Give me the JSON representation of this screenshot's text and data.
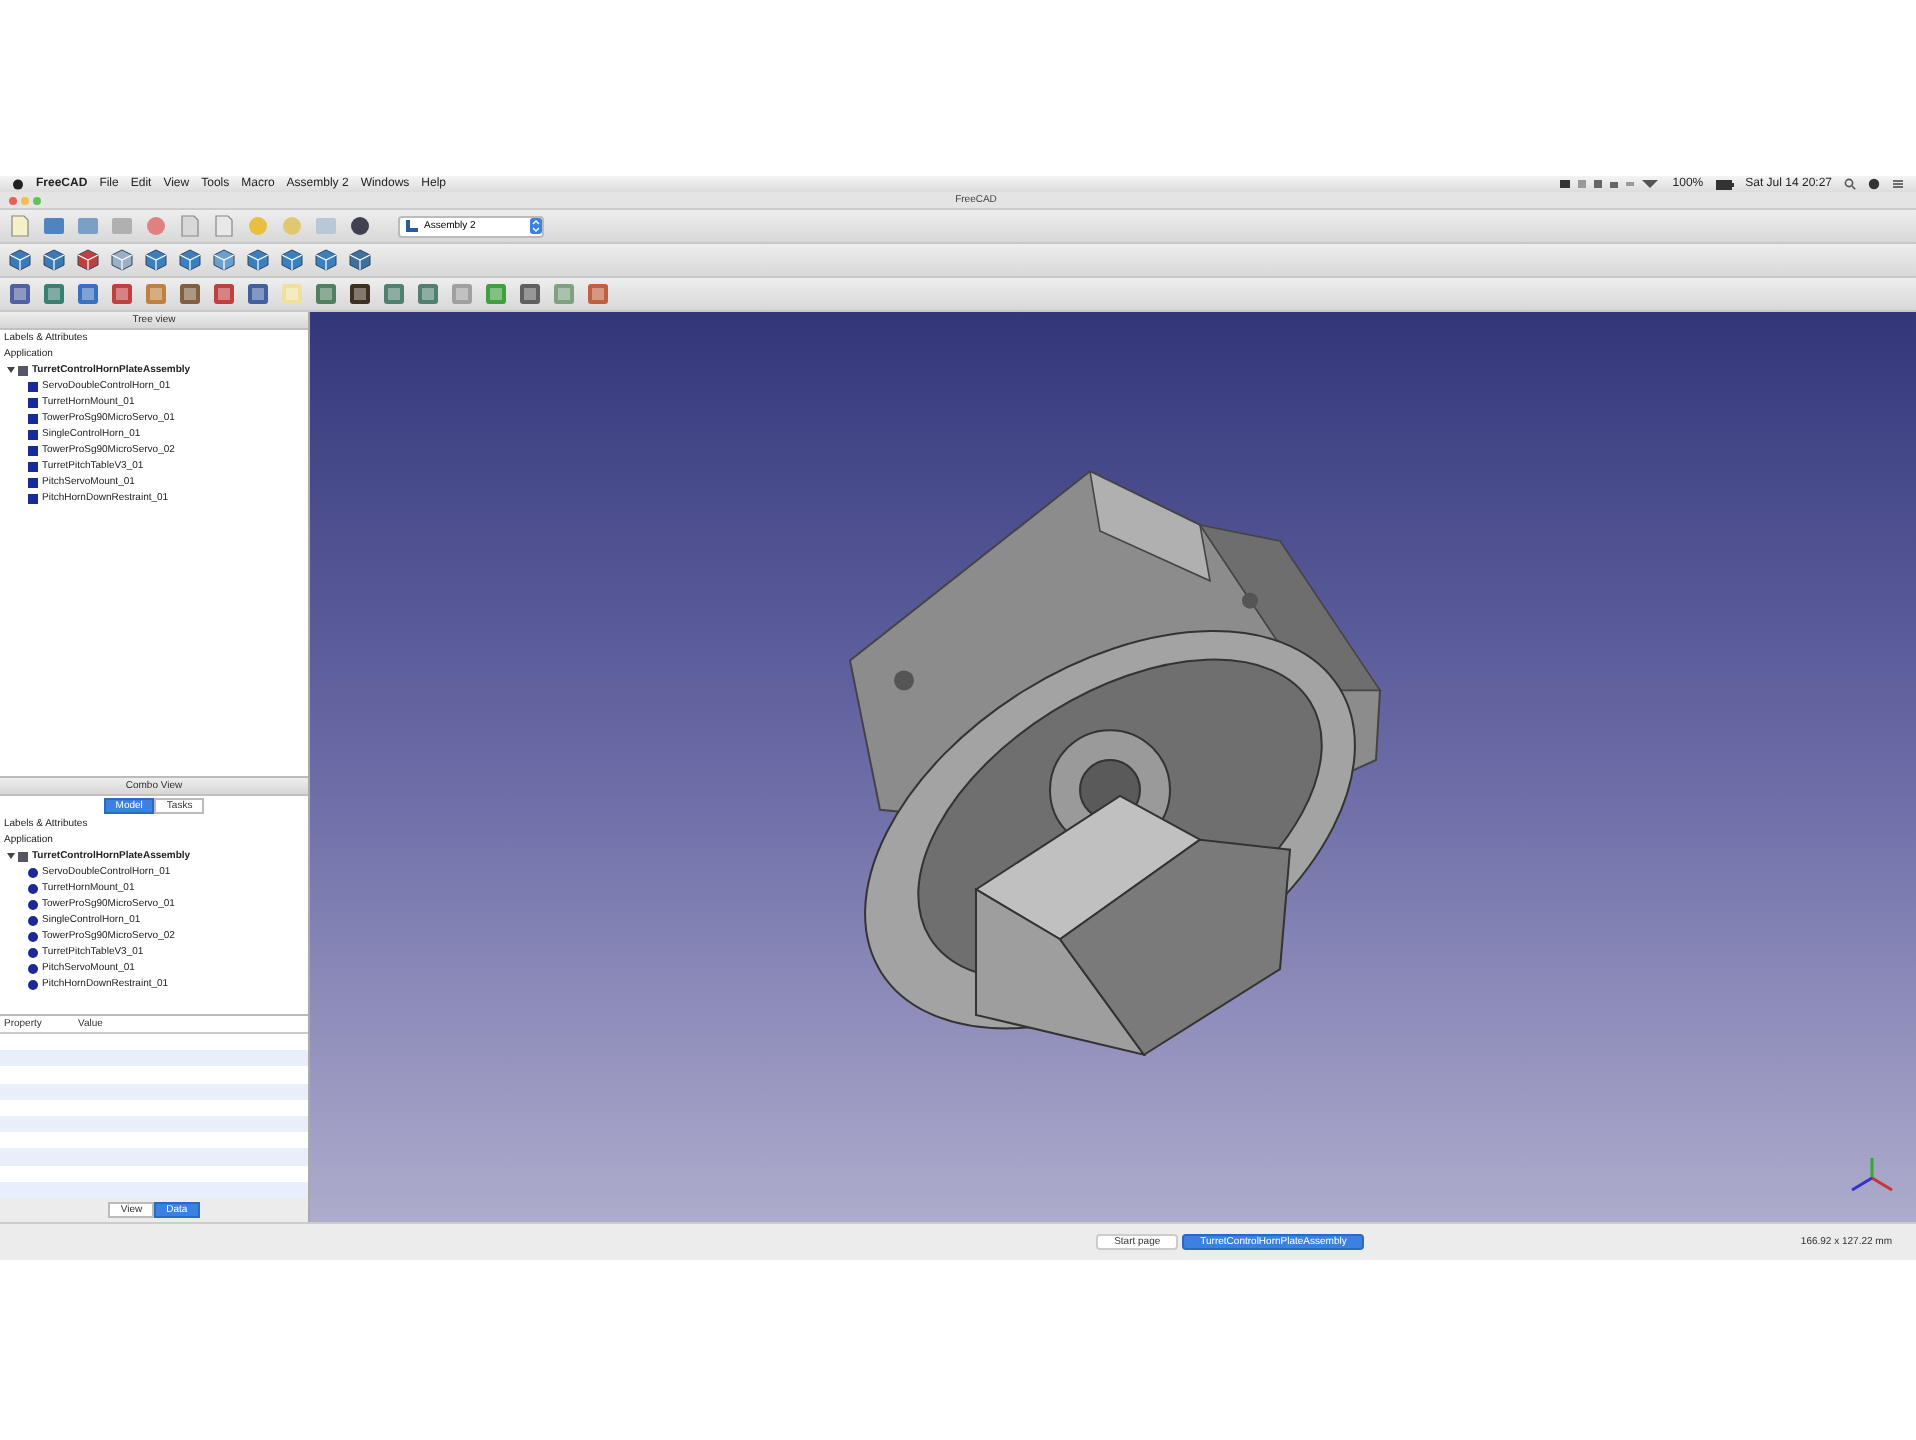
{
  "menu_bar": {
    "app": "FreeCAD",
    "items": [
      "File",
      "Edit",
      "View",
      "Tools",
      "Macro",
      "Assembly 2",
      "Windows",
      "Help"
    ],
    "battery": "100%",
    "clock": "Sat Jul 14 20:27"
  },
  "window": {
    "title": "FreeCAD"
  },
  "workbench_selector": {
    "value": "Assembly 2"
  },
  "tree_view": {
    "title": "Tree view",
    "header": "Labels & Attributes",
    "section": "Application",
    "root": {
      "label": "TurretControlHornPlateAssembly",
      "expanded": true,
      "children": [
        {
          "label": "ServoDoubleControlHorn_01"
        },
        {
          "label": "TurretHornMount_01"
        },
        {
          "label": "TowerProSg90MicroServo_01"
        },
        {
          "label": "SingleControlHorn_01"
        },
        {
          "label": "TowerProSg90MicroServo_02"
        },
        {
          "label": "TurretPitchTableV3_01"
        },
        {
          "label": "PitchServoMount_01"
        },
        {
          "label": "PitchHornDownRestraint_01"
        }
      ]
    }
  },
  "combo_view": {
    "title": "Combo View",
    "tabs": [
      {
        "label": "Model",
        "selected": true
      },
      {
        "label": "Tasks",
        "selected": false
      }
    ],
    "header": "Labels & Attributes",
    "section": "Application",
    "root": {
      "label": "TurretControlHornPlateAssembly",
      "expanded": true,
      "children": [
        {
          "label": "ServoDoubleControlHorn_01"
        },
        {
          "label": "TurretHornMount_01"
        },
        {
          "label": "TowerProSg90MicroServo_01"
        },
        {
          "label": "SingleControlHorn_01"
        },
        {
          "label": "TowerProSg90MicroServo_02"
        },
        {
          "label": "TurretPitchTableV3_01"
        },
        {
          "label": "PitchServoMount_01"
        },
        {
          "label": "PitchHornDownRestraint_01"
        }
      ]
    }
  },
  "property_table": {
    "columns": [
      "Property",
      "Value"
    ]
  },
  "property_tabs": [
    {
      "label": "View",
      "selected": false
    },
    {
      "label": "Data",
      "selected": true
    }
  ],
  "document_tabs": [
    {
      "label": "Start page",
      "selected": false
    },
    {
      "label": "TurretControlHornPlateAssembly",
      "selected": true
    }
  ],
  "status_bar": {
    "dimensions": "166.92 x 127.22 mm"
  }
}
